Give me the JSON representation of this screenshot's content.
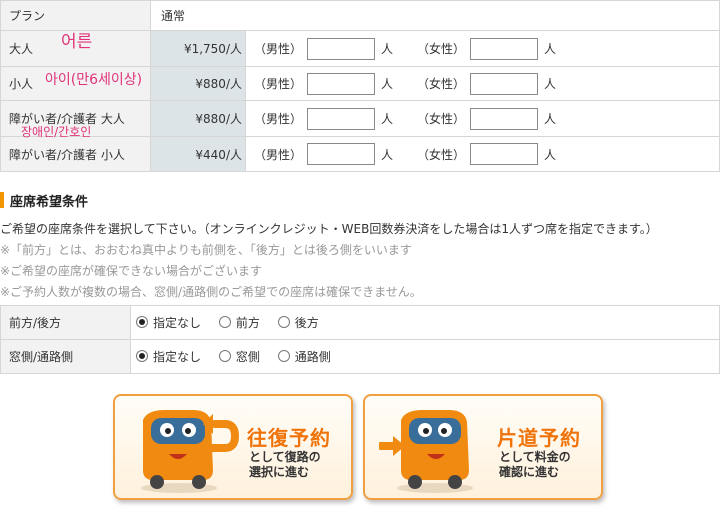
{
  "fare_table": {
    "plan": {
      "label": "プラン",
      "value": "通常"
    },
    "rows": [
      {
        "category": "大人",
        "handwriting": "어른",
        "price": "¥1,750/人"
      },
      {
        "category": "小人",
        "handwriting": "아이(만6세이상)",
        "price": "¥880/人"
      },
      {
        "category": "障がい者/介護者 大人",
        "handwriting": "장애인/간호인",
        "price": "¥880/人"
      },
      {
        "category": "障がい者/介護者 小人",
        "handwriting": "",
        "price": "¥440/人"
      }
    ],
    "male_label": "（男性）",
    "female_label": "（女性）",
    "unit": "人"
  },
  "seat_section": {
    "title": "座席希望条件",
    "notes": [
      "ご希望の座席条件を選択して下さい。（オンラインクレジット・WEB回数券決済をした場合は1人ずつ席を指定できます。）",
      "※「前方」とは、おおむね真中よりも前側を、「後方」とは後ろ側をいいます",
      "※ご希望の座席が確保できない場合がございます",
      "※ご予約人数が複数の場合、窓側/通路側のご希望での座席は確保できません。"
    ],
    "rows": [
      {
        "label": "前方/後方",
        "options": [
          "指定なし",
          "前方",
          "後方"
        ],
        "selected": 0
      },
      {
        "label": "窓側/通路側",
        "options": [
          "指定なし",
          "窓側",
          "通路側"
        ],
        "selected": 0
      }
    ]
  },
  "buttons": {
    "round_trip": {
      "title": "往復予約",
      "line1": "として復路の",
      "line2": "選択に進む"
    },
    "one_way": {
      "title": "片道予約",
      "line1": "として料金の",
      "line2": "確認に進む"
    }
  },
  "colors": {
    "accent": "#f29600",
    "button_title": "#f0730a",
    "handwriting": "#e0337a",
    "price_bg": "#dde4e8"
  }
}
